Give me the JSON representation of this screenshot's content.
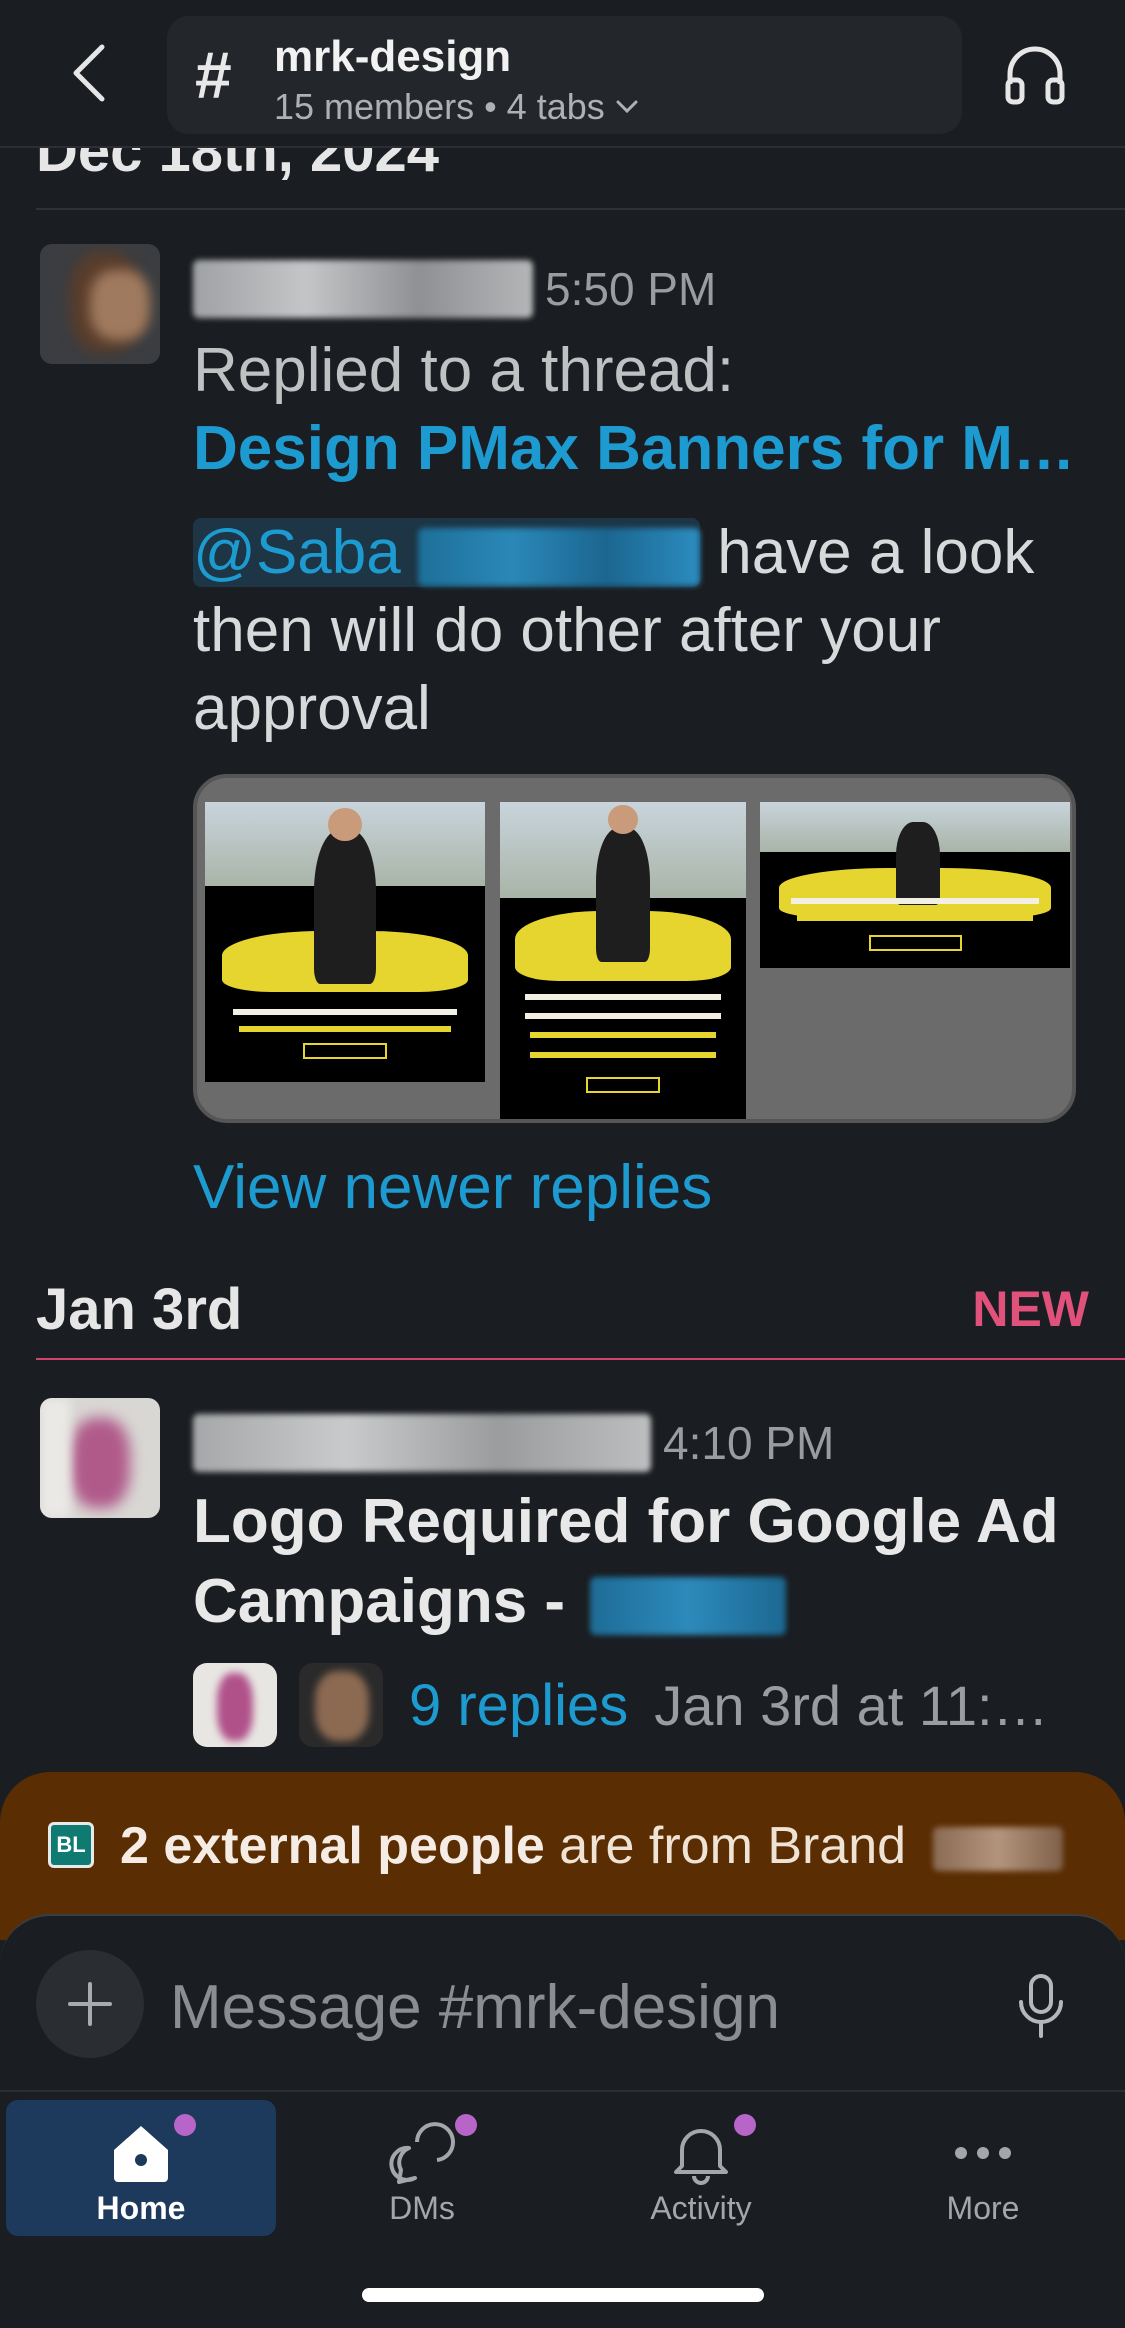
{
  "header": {
    "channel_hash": "#",
    "channel_name": "mrk-design",
    "meta": "15 members • 4 tabs"
  },
  "date_divider_1": "Dec 18th, 2024",
  "message1": {
    "time": "5:50 PM",
    "replied_label": "Replied to a thread:",
    "thread_title": "Design PMax Banners for M…",
    "mention": "@Saba",
    "text": " have a look then will do other after your approval",
    "view_newer": "View newer replies"
  },
  "date_divider_2": "Jan 3rd",
  "new_label": "NEW",
  "message2": {
    "time": "4:10 PM",
    "title": "Logo Required for Google Ad Campaigns -",
    "replies": "9 replies",
    "reply_time": "Jan 3rd at 11:…"
  },
  "external_notice": {
    "badge": "BL",
    "bold": "2 external people",
    "rest": " are from Brand"
  },
  "composer": {
    "placeholder": "Message #mrk-design"
  },
  "tabs": [
    {
      "label": "Home"
    },
    {
      "label": "DMs"
    },
    {
      "label": "Activity"
    },
    {
      "label": "More"
    }
  ],
  "colors": {
    "background": "#1a1d21",
    "link": "#1d9bd1",
    "new": "#e0527b",
    "external_banner": "#5b2d03",
    "active_tab": "#1d3a5c",
    "notification_dot": "#b765c9"
  }
}
